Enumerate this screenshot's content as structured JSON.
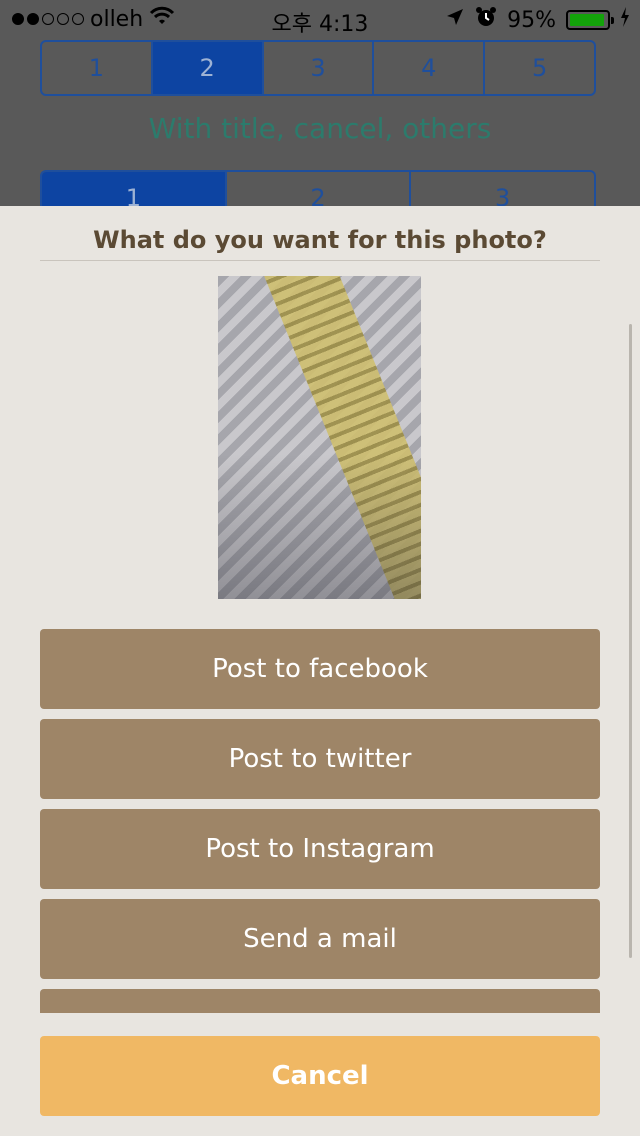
{
  "status_bar": {
    "carrier": "olleh",
    "time": "오후 4:13",
    "battery_percent": "95%",
    "battery_level": 0.95,
    "battery_color": "#13a20a",
    "signal_icon": "signal-dots-icon",
    "wifi_icon": "wifi-icon",
    "location_icon": "location-arrow-icon",
    "alarm_icon": "alarm-clock-icon",
    "charging_icon": "charging-bolt-icon"
  },
  "background": {
    "segments_top": [
      "1",
      "2",
      "3",
      "4",
      "5"
    ],
    "segments_top_selected": "2",
    "section_title": "With title, cancel, others",
    "segments_bottom": [
      "1",
      "2",
      "3"
    ],
    "segments_bottom_selected": "1"
  },
  "action_sheet": {
    "title": "What do you want for this photo?",
    "buttons": [
      {
        "label": "Post to facebook"
      },
      {
        "label": "Post to twitter"
      },
      {
        "label": "Post to Instagram"
      },
      {
        "label": "Send a mail"
      }
    ],
    "cancel_label": "Cancel",
    "colors": {
      "sheet_background": "#e8e5e0",
      "button": "#9e8567",
      "cancel": "#f0b864",
      "title": "#5b4a34"
    }
  }
}
